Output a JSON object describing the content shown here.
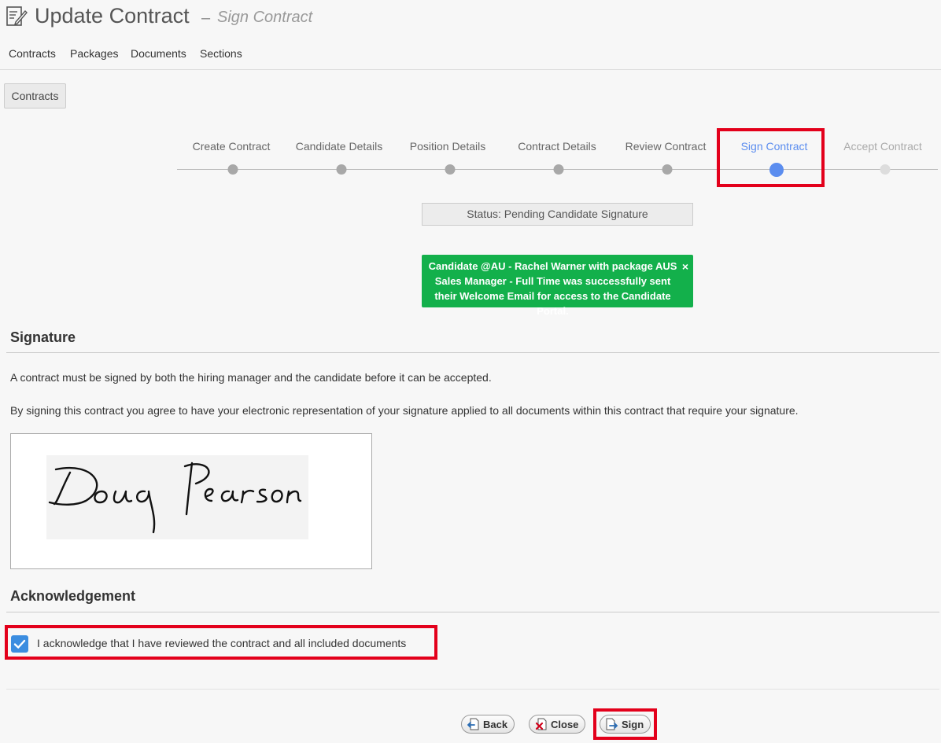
{
  "header": {
    "title": "Update Contract",
    "separator": "–",
    "subtitle": "Sign Contract"
  },
  "tabs": [
    {
      "label": "Contracts",
      "active": true
    },
    {
      "label": "Packages"
    },
    {
      "label": "Documents"
    },
    {
      "label": "Sections"
    }
  ],
  "contracts_button": "Contracts",
  "steps": [
    {
      "label": "Create Contract",
      "state": "done"
    },
    {
      "label": "Candidate Details",
      "state": "done"
    },
    {
      "label": "Position Details",
      "state": "done"
    },
    {
      "label": "Contract Details",
      "state": "done"
    },
    {
      "label": "Review Contract",
      "state": "done"
    },
    {
      "label": "Sign Contract",
      "state": "current"
    },
    {
      "label": "Accept Contract",
      "state": "future"
    }
  ],
  "status": "Status: Pending Candidate Signature",
  "alert": {
    "message": "Candidate @AU - Rachel Warner with package AUS Sales Manager - Full Time was successfully sent their Welcome Email for access to the Candidate Portal.",
    "close": "×"
  },
  "signature": {
    "title": "Signature",
    "text1": "A contract must be signed by both the hiring manager and the candidate before it can be accepted.",
    "text2": "By signing this contract you agree to have your electronic representation of your signature applied to all documents within this contract that require your signature.",
    "signature_name": "Doug Pearson"
  },
  "acknowledgement": {
    "title": "Acknowledgement",
    "label": "I acknowledge that I have reviewed the contract and all included documents",
    "checked": true
  },
  "footer": {
    "back": "Back",
    "close": "Close",
    "sign": "Sign"
  },
  "colors": {
    "highlight": "#e3001b",
    "accent": "#5b8def",
    "success": "#13b04b",
    "checkbox": "#3b8de0"
  }
}
